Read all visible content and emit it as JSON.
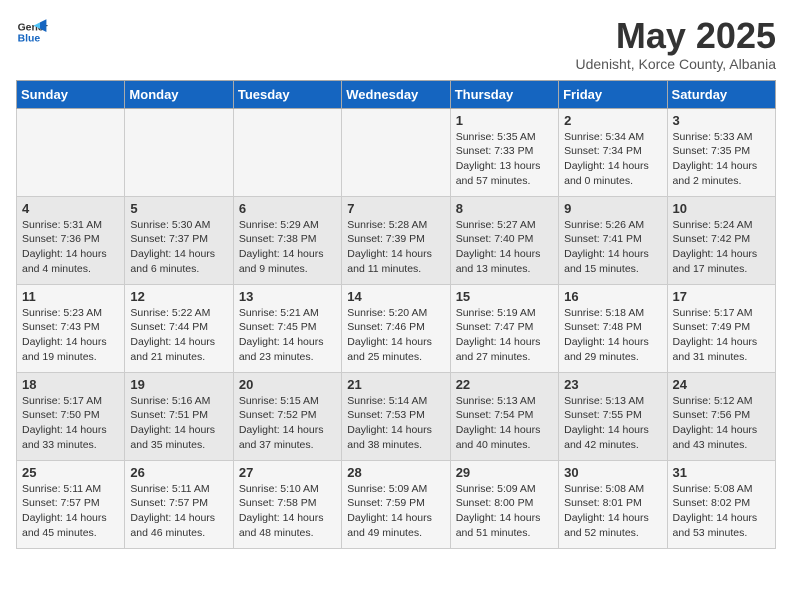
{
  "header": {
    "logo": {
      "general": "General",
      "blue": "Blue"
    },
    "month": "May 2025",
    "location": "Udenisht, Korce County, Albania"
  },
  "days_of_week": [
    "Sunday",
    "Monday",
    "Tuesday",
    "Wednesday",
    "Thursday",
    "Friday",
    "Saturday"
  ],
  "weeks": [
    [
      {
        "day": "",
        "info": ""
      },
      {
        "day": "",
        "info": ""
      },
      {
        "day": "",
        "info": ""
      },
      {
        "day": "",
        "info": ""
      },
      {
        "day": "1",
        "info": "Sunrise: 5:35 AM\nSunset: 7:33 PM\nDaylight: 13 hours and 57 minutes."
      },
      {
        "day": "2",
        "info": "Sunrise: 5:34 AM\nSunset: 7:34 PM\nDaylight: 14 hours and 0 minutes."
      },
      {
        "day": "3",
        "info": "Sunrise: 5:33 AM\nSunset: 7:35 PM\nDaylight: 14 hours and 2 minutes."
      }
    ],
    [
      {
        "day": "4",
        "info": "Sunrise: 5:31 AM\nSunset: 7:36 PM\nDaylight: 14 hours and 4 minutes."
      },
      {
        "day": "5",
        "info": "Sunrise: 5:30 AM\nSunset: 7:37 PM\nDaylight: 14 hours and 6 minutes."
      },
      {
        "day": "6",
        "info": "Sunrise: 5:29 AM\nSunset: 7:38 PM\nDaylight: 14 hours and 9 minutes."
      },
      {
        "day": "7",
        "info": "Sunrise: 5:28 AM\nSunset: 7:39 PM\nDaylight: 14 hours and 11 minutes."
      },
      {
        "day": "8",
        "info": "Sunrise: 5:27 AM\nSunset: 7:40 PM\nDaylight: 14 hours and 13 minutes."
      },
      {
        "day": "9",
        "info": "Sunrise: 5:26 AM\nSunset: 7:41 PM\nDaylight: 14 hours and 15 minutes."
      },
      {
        "day": "10",
        "info": "Sunrise: 5:24 AM\nSunset: 7:42 PM\nDaylight: 14 hours and 17 minutes."
      }
    ],
    [
      {
        "day": "11",
        "info": "Sunrise: 5:23 AM\nSunset: 7:43 PM\nDaylight: 14 hours and 19 minutes."
      },
      {
        "day": "12",
        "info": "Sunrise: 5:22 AM\nSunset: 7:44 PM\nDaylight: 14 hours and 21 minutes."
      },
      {
        "day": "13",
        "info": "Sunrise: 5:21 AM\nSunset: 7:45 PM\nDaylight: 14 hours and 23 minutes."
      },
      {
        "day": "14",
        "info": "Sunrise: 5:20 AM\nSunset: 7:46 PM\nDaylight: 14 hours and 25 minutes."
      },
      {
        "day": "15",
        "info": "Sunrise: 5:19 AM\nSunset: 7:47 PM\nDaylight: 14 hours and 27 minutes."
      },
      {
        "day": "16",
        "info": "Sunrise: 5:18 AM\nSunset: 7:48 PM\nDaylight: 14 hours and 29 minutes."
      },
      {
        "day": "17",
        "info": "Sunrise: 5:17 AM\nSunset: 7:49 PM\nDaylight: 14 hours and 31 minutes."
      }
    ],
    [
      {
        "day": "18",
        "info": "Sunrise: 5:17 AM\nSunset: 7:50 PM\nDaylight: 14 hours and 33 minutes."
      },
      {
        "day": "19",
        "info": "Sunrise: 5:16 AM\nSunset: 7:51 PM\nDaylight: 14 hours and 35 minutes."
      },
      {
        "day": "20",
        "info": "Sunrise: 5:15 AM\nSunset: 7:52 PM\nDaylight: 14 hours and 37 minutes."
      },
      {
        "day": "21",
        "info": "Sunrise: 5:14 AM\nSunset: 7:53 PM\nDaylight: 14 hours and 38 minutes."
      },
      {
        "day": "22",
        "info": "Sunrise: 5:13 AM\nSunset: 7:54 PM\nDaylight: 14 hours and 40 minutes."
      },
      {
        "day": "23",
        "info": "Sunrise: 5:13 AM\nSunset: 7:55 PM\nDaylight: 14 hours and 42 minutes."
      },
      {
        "day": "24",
        "info": "Sunrise: 5:12 AM\nSunset: 7:56 PM\nDaylight: 14 hours and 43 minutes."
      }
    ],
    [
      {
        "day": "25",
        "info": "Sunrise: 5:11 AM\nSunset: 7:57 PM\nDaylight: 14 hours and 45 minutes."
      },
      {
        "day": "26",
        "info": "Sunrise: 5:11 AM\nSunset: 7:57 PM\nDaylight: 14 hours and 46 minutes."
      },
      {
        "day": "27",
        "info": "Sunrise: 5:10 AM\nSunset: 7:58 PM\nDaylight: 14 hours and 48 minutes."
      },
      {
        "day": "28",
        "info": "Sunrise: 5:09 AM\nSunset: 7:59 PM\nDaylight: 14 hours and 49 minutes."
      },
      {
        "day": "29",
        "info": "Sunrise: 5:09 AM\nSunset: 8:00 PM\nDaylight: 14 hours and 51 minutes."
      },
      {
        "day": "30",
        "info": "Sunrise: 5:08 AM\nSunset: 8:01 PM\nDaylight: 14 hours and 52 minutes."
      },
      {
        "day": "31",
        "info": "Sunrise: 5:08 AM\nSunset: 8:02 PM\nDaylight: 14 hours and 53 minutes."
      }
    ]
  ]
}
